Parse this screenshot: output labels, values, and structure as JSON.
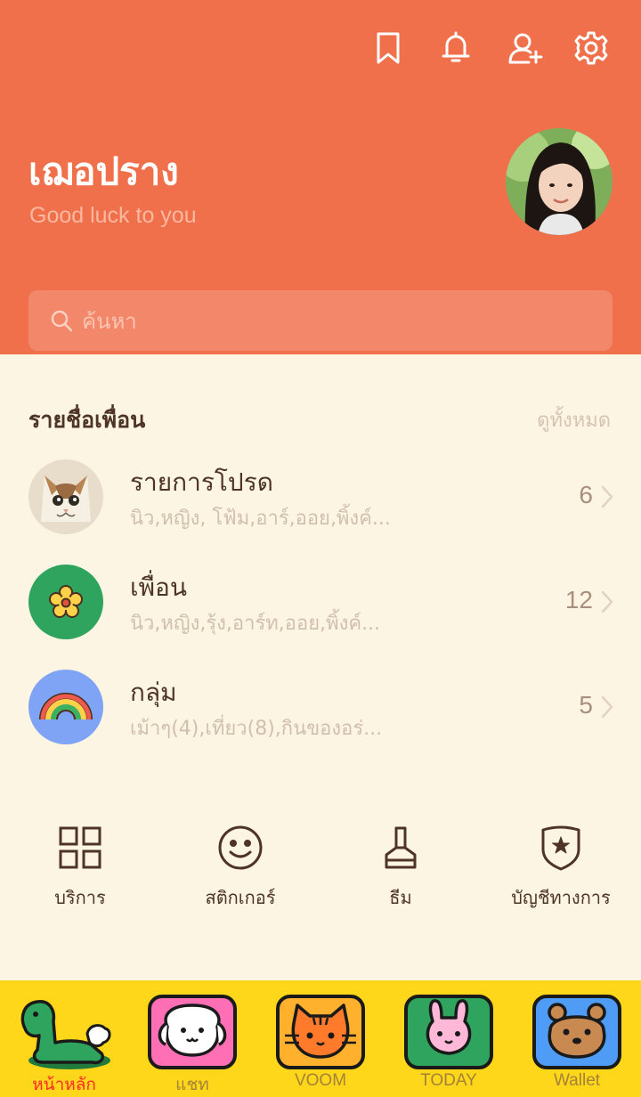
{
  "header": {
    "icons": [
      "bookmark-icon",
      "bell-icon",
      "add-friend-icon",
      "gear-icon"
    ],
    "bg_color": "#f0704c"
  },
  "profile": {
    "name": "เฌอปราง",
    "status": "Good luck to you"
  },
  "search": {
    "placeholder": "ค้นหา"
  },
  "friends": {
    "title": "รายชื่อเพื่อน",
    "see_all": "ดูทั้งหมด",
    "rows": [
      {
        "title": "รายการโปรด",
        "subtitle": "นิว,หญิง, โฟ้ม,อาร์,ออย,พิ้งค์...",
        "count": "6",
        "icon": "cat-photo"
      },
      {
        "title": "เพื่อน",
        "subtitle": "นิว,หญิง,รุ้ง,อาร์ท,ออย,พิ้งค์...",
        "count": "12",
        "icon": "flower-icon"
      },
      {
        "title": "กลุ่ม",
        "subtitle": "เม้าๆ(4),เที่ยว(8),กินของอร่...",
        "count": "5",
        "icon": "rainbow-icon"
      }
    ]
  },
  "services": [
    {
      "label": "บริการ",
      "icon": "grid-icon"
    },
    {
      "label": "สติกเกอร์",
      "icon": "smiley-icon"
    },
    {
      "label": "ธีม",
      "icon": "brush-icon"
    },
    {
      "label": "บัญชีทางการ",
      "icon": "official-badge-icon"
    }
  ],
  "tabs": [
    {
      "label": "หน้าหลัก",
      "icon": "dino-icon",
      "active": true
    },
    {
      "label": "แชท",
      "icon": "puppy-icon",
      "active": false
    },
    {
      "label": "VOOM",
      "icon": "cat-icon",
      "active": false
    },
    {
      "label": "TODAY",
      "icon": "bunny-icon",
      "active": false
    },
    {
      "label": "Wallet",
      "icon": "bear-icon",
      "active": false
    }
  ],
  "colors": {
    "accent": "#f0704c",
    "background": "#fdf5e3",
    "tabbar": "#ffd71a",
    "text": "#4e3427"
  }
}
